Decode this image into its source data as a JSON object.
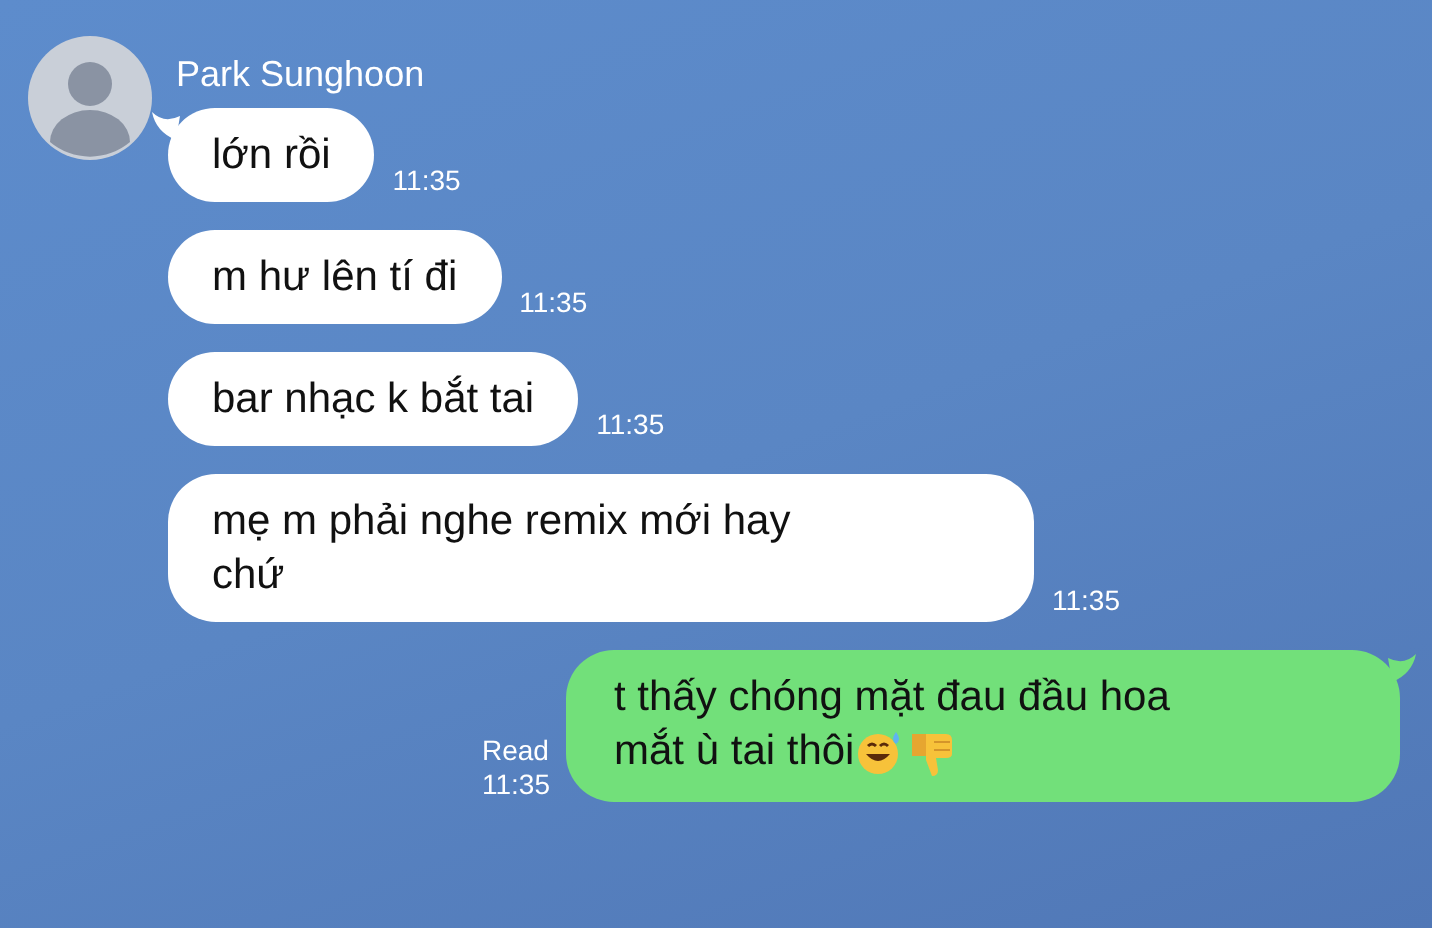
{
  "contact": {
    "name": "Park Sunghoon"
  },
  "messages": [
    {
      "kind": "incoming",
      "lines": [
        "lớn rồi"
      ],
      "time": "11:35",
      "tail": true
    },
    {
      "kind": "incoming",
      "lines": [
        "m hư lên tí đi"
      ],
      "time": "11:35",
      "tail": false
    },
    {
      "kind": "incoming",
      "lines": [
        "bar nhạc k bắt tai"
      ],
      "time": "11:35",
      "tail": false
    },
    {
      "kind": "incoming",
      "lines": [
        "mẹ m phải nghe remix mới hay",
        "chứ"
      ],
      "time": "11:35",
      "tail": false
    },
    {
      "kind": "outgoing",
      "lines": [
        "t thấy chóng mặt đau đầu hoa",
        "mắt ù tai thôi"
      ],
      "trailing_icons": [
        {
          "kind": "sweat-smile"
        },
        {
          "kind": "thumbs-down"
        }
      ],
      "read": "Read",
      "time": "11:35",
      "tail": true
    }
  ]
}
